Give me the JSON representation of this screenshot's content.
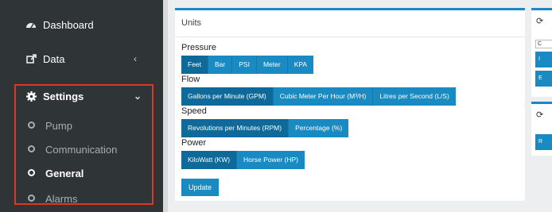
{
  "sidebar": {
    "dashboard": "Dashboard",
    "data": "Data",
    "settings": "Settings",
    "sub": {
      "pump": "Pump",
      "communication": "Communication",
      "general": "General",
      "alarms": "Alarms"
    },
    "selected": "General"
  },
  "units_card": {
    "title": "Units",
    "pressure": {
      "label": "Pressure",
      "options": [
        "Feet",
        "Bar",
        "PSI",
        "Meter",
        "KPA"
      ],
      "selected": "Feet"
    },
    "flow": {
      "label": "Flow",
      "options": [
        "Gallons per Minute (GPM)",
        "Cubic Meter Per Hour (M³/H)",
        "Litres per Second (L/S)"
      ],
      "selected": "Gallons per Minute (GPM)"
    },
    "speed": {
      "label": "Speed",
      "options": [
        "Revolutions per Minutes (RPM)",
        "Percentage (%)"
      ],
      "selected": "Revolutions per Minutes (RPM)"
    },
    "power": {
      "label": "Power",
      "options": [
        "KiloWatt (KW)",
        "Horse Power (HP)"
      ],
      "selected": "KiloWatt (KW)"
    },
    "update_label": "Update"
  },
  "right_cards": {
    "refresh_icon": "refresh-icon",
    "input_text": "C",
    "btn1": "I",
    "btn2": "E",
    "btn3": "R"
  },
  "colors": {
    "accent": "#1a88c9",
    "button": "#1a8ac2",
    "button_active": "#0f6a9a",
    "highlight_border": "#e03628",
    "sidebar_bg": "#2f3437"
  }
}
